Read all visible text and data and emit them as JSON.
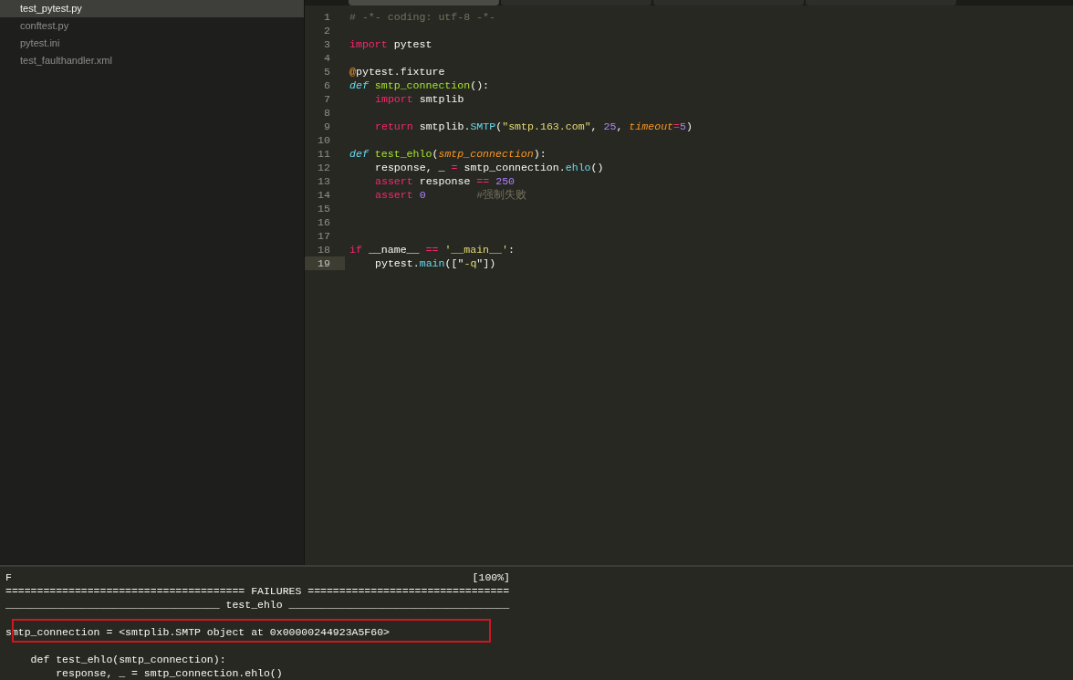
{
  "tabs": [
    {
      "selected": true
    },
    {
      "selected": false
    },
    {
      "selected": false
    },
    {
      "selected": false
    }
  ],
  "sidebar": {
    "files": [
      {
        "name": "test_pytest.py",
        "selected": true
      },
      {
        "name": "conftest.py",
        "selected": false
      },
      {
        "name": "pytest.ini",
        "selected": false
      },
      {
        "name": "test_faulthandler.xml",
        "selected": false
      }
    ]
  },
  "editor": {
    "lines": [
      {
        "number": "1",
        "current": false,
        "tokens": [
          {
            "kind": "comment",
            "text": "# -*- coding: utf-8 -*-"
          }
        ]
      },
      {
        "number": "2",
        "current": false
      },
      {
        "number": "3",
        "current": false,
        "tokens": [
          {
            "kind": "keyword",
            "text": "import"
          },
          {
            "kind": "plain",
            "text": " pytest"
          }
        ]
      },
      {
        "number": "4",
        "current": false
      },
      {
        "number": "5",
        "current": false,
        "tokens": [
          {
            "kind": "decorator",
            "text": "@"
          },
          {
            "kind": "plain",
            "text": "pytest.fixture"
          }
        ]
      },
      {
        "number": "6",
        "current": false,
        "tokens": [
          {
            "kind": "storage",
            "text": "def"
          },
          {
            "kind": "function",
            "text": " smtp_connection"
          },
          {
            "kind": "plain",
            "text": "():"
          }
        ]
      },
      {
        "number": "7",
        "current": false,
        "indented": true,
        "tokens": [
          {
            "kind": "keyword",
            "text": "import"
          },
          {
            "kind": "plain",
            "text": " smtplib"
          }
        ]
      },
      {
        "number": "8",
        "current": false
      },
      {
        "number": "9",
        "current": false,
        "indented": true,
        "tokens": [
          {
            "kind": "keyword",
            "text": "return"
          },
          {
            "kind": "plain",
            "text": " smtplib."
          },
          {
            "kind": "support",
            "text": "SMTP"
          },
          {
            "kind": "plain",
            "text": "("
          },
          {
            "kind": "string",
            "text": "\"smtp.163.com\""
          },
          {
            "kind": "plain",
            "text": ", "
          },
          {
            "kind": "number",
            "text": "25"
          },
          {
            "kind": "plain",
            "text": ", "
          },
          {
            "kind": "param",
            "text": "timeout"
          },
          {
            "kind": "keyword",
            "text": "="
          },
          {
            "kind": "number",
            "text": "5"
          },
          {
            "kind": "plain",
            "text": ")"
          }
        ]
      },
      {
        "number": "10",
        "current": false
      },
      {
        "number": "11",
        "current": false,
        "tokens": [
          {
            "kind": "storage",
            "text": "def"
          },
          {
            "kind": "function",
            "text": " test_ehlo"
          },
          {
            "kind": "plain",
            "text": "("
          },
          {
            "kind": "param",
            "text": "smtp_connection"
          },
          {
            "kind": "plain",
            "text": "):"
          }
        ]
      },
      {
        "number": "12",
        "current": false,
        "indented": true,
        "tokens": [
          {
            "kind": "plain",
            "text": "response, _ "
          },
          {
            "kind": "keyword",
            "text": "="
          },
          {
            "kind": "plain",
            "text": " smtp_connection."
          },
          {
            "kind": "support",
            "text": "ehlo"
          },
          {
            "kind": "plain",
            "text": "()"
          }
        ]
      },
      {
        "number": "13",
        "current": false,
        "indented": true,
        "tokens": [
          {
            "kind": "keyword",
            "text": "assert"
          },
          {
            "kind": "plain",
            "text": " response "
          },
          {
            "kind": "keyword",
            "text": "=="
          },
          {
            "kind": "number",
            "text": " 250"
          }
        ]
      },
      {
        "number": "14",
        "current": false,
        "indented": true,
        "tokens": [
          {
            "kind": "keyword",
            "text": "assert"
          },
          {
            "kind": "number",
            "text": " 0"
          },
          {
            "kind": "comment",
            "text": "        #强制失败"
          }
        ]
      },
      {
        "number": "15",
        "current": false
      },
      {
        "number": "16",
        "current": false
      },
      {
        "number": "17",
        "current": false
      },
      {
        "number": "18",
        "current": false,
        "tokens": [
          {
            "kind": "keyword",
            "text": "if"
          },
          {
            "kind": "plain",
            "text": " __name__ "
          },
          {
            "kind": "keyword",
            "text": "=="
          },
          {
            "kind": "string",
            "text": " '__main__'"
          },
          {
            "kind": "plain",
            "text": ":"
          }
        ]
      },
      {
        "number": "19",
        "current": true,
        "indented": true,
        "tokens": [
          {
            "kind": "plain",
            "text": "pytest."
          },
          {
            "kind": "support",
            "text": "main"
          },
          {
            "kind": "plain",
            "text": "([\""
          },
          {
            "kind": "string",
            "text": "-q"
          },
          {
            "kind": "plain",
            "text": "\"])"
          }
        ]
      }
    ]
  },
  "output": {
    "lines": [
      {
        "kind": "progress",
        "text": "F",
        "reading": "[100%]",
        "boxed": false
      },
      {
        "kind": "text",
        "text": "====================================== FAILURES ================================",
        "boxed": false
      },
      {
        "kind": "text",
        "text": "__________________________________ test_ehlo ___________________________________",
        "boxed": false
      },
      {
        "kind": "blank",
        "boxed": false
      },
      {
        "kind": "text",
        "text": "smtp_connection = <smtplib.SMTP object at 0x00000244923A5F60>",
        "boxed": true
      },
      {
        "kind": "blank",
        "boxed": false
      },
      {
        "kind": "text",
        "text": "    def test_ehlo(smtp_connection):",
        "boxed": false
      },
      {
        "kind": "text",
        "text": "        response, _ = smtp_connection.ehlo()",
        "boxed": false
      }
    ]
  }
}
